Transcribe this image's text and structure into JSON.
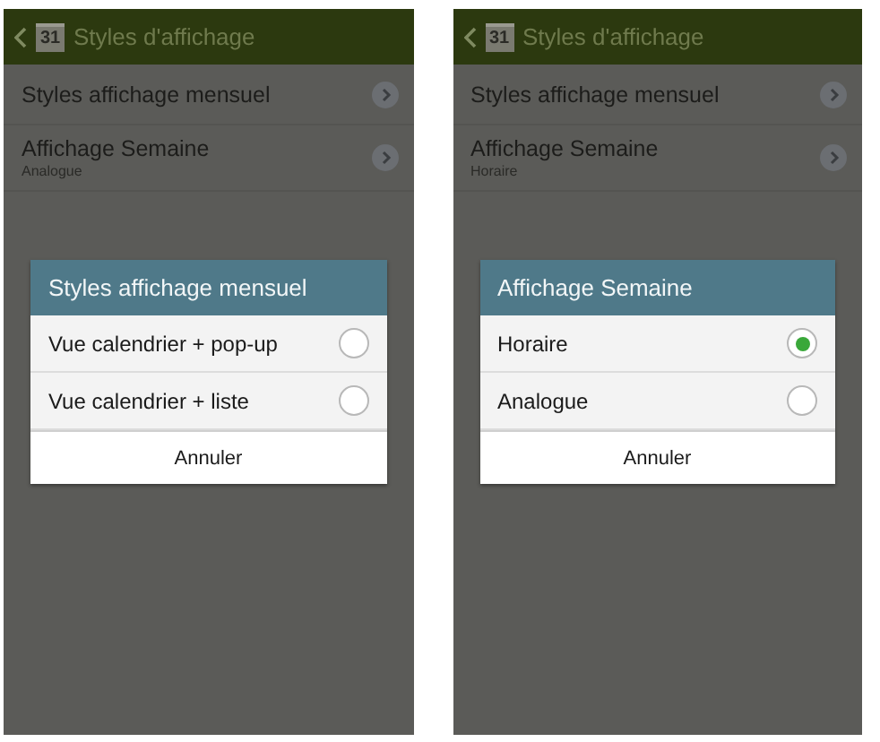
{
  "screens": [
    {
      "header": {
        "calendar_day": "31",
        "title": "Styles d'affichage"
      },
      "settings": [
        {
          "label": "Styles affichage mensuel"
        },
        {
          "label": "Affichage Semaine",
          "value": "Analogue"
        }
      ],
      "dialog": {
        "title": "Styles affichage mensuel",
        "options": [
          {
            "label": "Vue calendrier + pop-up",
            "selected": false
          },
          {
            "label": "Vue calendrier + liste",
            "selected": false
          }
        ],
        "button": "Annuler"
      }
    },
    {
      "header": {
        "calendar_day": "31",
        "title": "Styles d'affichage"
      },
      "settings": [
        {
          "label": "Styles affichage mensuel"
        },
        {
          "label": "Affichage Semaine",
          "value": "Horaire"
        }
      ],
      "dialog": {
        "title": "Affichage Semaine",
        "options": [
          {
            "label": "Horaire",
            "selected": true
          },
          {
            "label": "Analogue",
            "selected": false
          }
        ],
        "button": "Annuler"
      }
    }
  ]
}
